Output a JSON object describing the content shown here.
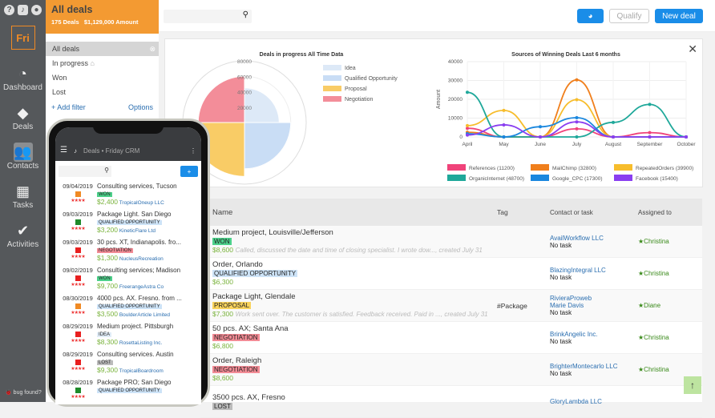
{
  "sidebar": {
    "top_icons": [
      "help-icon",
      "bell-icon",
      "user-icon"
    ],
    "logo": "Fri",
    "items": [
      {
        "label": "Dashboard",
        "icon": "gauge"
      },
      {
        "label": "Deals",
        "icon": "deal-badge"
      },
      {
        "label": "Contacts",
        "icon": "contacts"
      },
      {
        "label": "Tasks",
        "icon": "calendar"
      },
      {
        "label": "Activities",
        "icon": "check"
      }
    ],
    "bug": "bug found?"
  },
  "filters": {
    "title": "All deals",
    "deals_count": "175 Deals",
    "amount": "$1,129,000 Amount",
    "items": [
      "All deals",
      "In progress",
      "Won",
      "Lost"
    ],
    "add_filter": "+ Add filter",
    "options": "Options"
  },
  "toolbar": {
    "search_placeholder": "",
    "qualify": "Qualify",
    "new_deal": "New deal"
  },
  "chart_data": [
    {
      "type": "polar-area",
      "title": "Deals in progress All Time Data",
      "rlim": [
        0,
        80000
      ],
      "ticks": [
        "80000",
        "60000",
        "40000",
        "20000"
      ],
      "categories": [
        "Idea",
        "Qualified Opportunity",
        "Proposal",
        "Negotiation"
      ],
      "values": [
        45000,
        60000,
        70000,
        60000
      ],
      "colors": [
        "#dde9f7",
        "#c9ddf5",
        "#f9cc66",
        "#f38d99"
      ]
    },
    {
      "type": "line",
      "title": "Sources of Winning Deals Last 6 months",
      "ylabel": "Amount",
      "ylim": [
        0,
        40000
      ],
      "yticks": [
        "0",
        "10000",
        "20000",
        "30000",
        "40000"
      ],
      "categories": [
        "April",
        "May",
        "June",
        "July",
        "August",
        "September",
        "October"
      ],
      "series": [
        {
          "name": "References (11200)",
          "color": "#f0437a",
          "values": [
            4600,
            0,
            0,
            4300,
            0,
            2300,
            0
          ]
        },
        {
          "name": "MailChimp (32800)",
          "color": "#f07f1c",
          "values": [
            2500,
            0,
            0,
            30300,
            0,
            0,
            0
          ]
        },
        {
          "name": "RepeatedOrders (39900)",
          "color": "#f7bd2c",
          "values": [
            6000,
            14100,
            0,
            19800,
            0,
            0,
            0
          ]
        },
        {
          "name": "OrganicInternet (48700)",
          "color": "#1fa89a",
          "values": [
            23700,
            0,
            0,
            0,
            7700,
            17300,
            0
          ]
        },
        {
          "name": "Google_CPC (17300)",
          "color": "#1a87de",
          "values": [
            1700,
            0,
            5400,
            10200,
            0,
            0,
            0
          ]
        },
        {
          "name": "Facebook (15400)",
          "color": "#8a3ef0",
          "values": [
            1000,
            6400,
            0,
            8000,
            0,
            0,
            0
          ]
        }
      ]
    }
  ],
  "table": {
    "headers": [
      "Name",
      "Tag",
      "Contact or task",
      "Assigned to"
    ],
    "rows": [
      {
        "name": "Medium project, Louisville/Jefferson",
        "stage": "WON",
        "cls": "b-won",
        "amount": "$8,600",
        "note": "Called, discussed the date and time of closing specialist. I wrote dow..., created July 31",
        "tag": "",
        "contacts": [
          "AvailWorkflow LLC"
        ],
        "task": "No task",
        "assigned": "★Christina"
      },
      {
        "name": "Order, Orlando",
        "stage": "QUALIFIED OPPORTUNITY",
        "cls": "b-qual",
        "amount": "$6,300",
        "note": "",
        "tag": "",
        "contacts": [
          "BlazingIntegral LLC"
        ],
        "task": "No task",
        "assigned": "★Christina"
      },
      {
        "name": "Package Light, Glendale",
        "stage": "PROPOSAL",
        "cls": "b-prop",
        "amount": "$7,300",
        "note": "Work sent over. The customer is satisfied. Feedback received. Paid in ..., created July 31",
        "tag": "#Package",
        "contacts": [
          "RivieraProweb",
          "Marie Davis"
        ],
        "task": "No task",
        "assigned": "★Diane"
      },
      {
        "name": "50 pcs. AX; Santa Ana",
        "stage": "NEGOTIATION",
        "cls": "b-neg",
        "amount": "$6,800",
        "note": "",
        "tag": "",
        "contacts": [
          "BrinkAngelic Inc."
        ],
        "task": "No task",
        "assigned": "★Christina"
      },
      {
        "name": "Order, Raleigh",
        "stage": "NEGOTIATION",
        "cls": "b-neg",
        "amount": "$8,600",
        "note": "",
        "tag": "",
        "contacts": [
          "BrighterMontecarlo LLC"
        ],
        "task": "No task",
        "assigned": "★Christina"
      },
      {
        "name": "3500 pcs. AX, Fresno",
        "stage": "LOST",
        "cls": "b-lost",
        "amount": "",
        "note": "",
        "tag": "",
        "contacts": [
          "GloryLambda LLC"
        ],
        "task": "",
        "assigned": ""
      }
    ]
  },
  "phone": {
    "title": "Deals • Friday CRM",
    "add": "+",
    "items": [
      {
        "date": "09/04/2019",
        "color": "#f08a24",
        "name": "Consulting services, Tucson",
        "stage": "WON",
        "cls": "b-won",
        "amount": "$2,400",
        "company": "TropicalOneup LLC"
      },
      {
        "date": "09/03/2019",
        "color": "#1f8a2a",
        "name": "Package Light. San Diego",
        "stage": "QUALIFIED OPPORTUNITY",
        "cls": "b-qual",
        "amount": "$3,200",
        "company": "KineticFlare Ltd"
      },
      {
        "date": "09/03/2019",
        "color": "#e82020",
        "name": "30 pcs. XT, Indianapolis. fro...",
        "stage": "NEGOTIATION",
        "cls": "b-neg",
        "amount": "$1,300",
        "company": "NucleusRecreation"
      },
      {
        "date": "09/02/2019",
        "color": "#e82020",
        "name": "Consulting services; Madison",
        "stage": "WON",
        "cls": "b-won",
        "amount": "$9,700",
        "company": "FreerangeAstra Co"
      },
      {
        "date": "08/30/2019",
        "color": "#f08a24",
        "name": "4000 pcs. AX. Fresno. from ...",
        "stage": "QUALIFIED OPPORTUNITY",
        "cls": "b-qual",
        "amount": "$3,500",
        "company": "BoulderArticle Limited"
      },
      {
        "date": "08/29/2019",
        "color": "#e82020",
        "name": "Medium project. Pittsburgh",
        "stage": "IDEA",
        "cls": "b-idea",
        "amount": "$8,300",
        "company": "RosettaListing Inc."
      },
      {
        "date": "08/29/2019",
        "color": "#e82020",
        "name": "Consulting services. Austin",
        "stage": "LOST",
        "cls": "b-lost",
        "amount": "$9,300",
        "company": "TropicalBoardroom"
      },
      {
        "date": "08/28/2019",
        "color": "#1f8a2a",
        "name": "Package PRO; San Diego",
        "stage": "QUALIFIED OPPORTUNITY",
        "cls": "b-qual",
        "amount": "",
        "company": ""
      }
    ]
  }
}
